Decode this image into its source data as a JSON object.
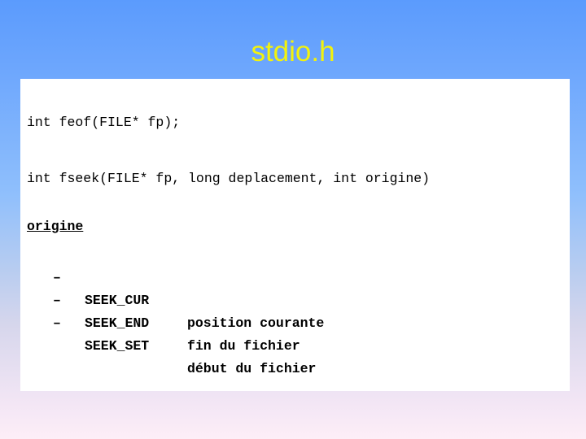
{
  "slide": {
    "title": "stdio.h",
    "title_color": "#f2f20d",
    "background_top_color": "#5b9bfd",
    "background_bottom_color": "#fdeef7",
    "panel_color": "#ffffff"
  },
  "code": {
    "line_1": "int feof(FILE* fp);",
    "line_2": "int fseek(FILE* fp, long deplacement, int origine)"
  },
  "origine": {
    "heading": "origine",
    "bullet_glyph": "–",
    "items": [
      {
        "bullet": "–",
        "code": "SEEK_CUR",
        "description": "position courante"
      },
      {
        "bullet": "–",
        "code": "SEEK_END",
        "description": "fin du fichier"
      },
      {
        "bullet": "–",
        "code": "SEEK_SET",
        "description": "début du fichier"
      }
    ]
  }
}
